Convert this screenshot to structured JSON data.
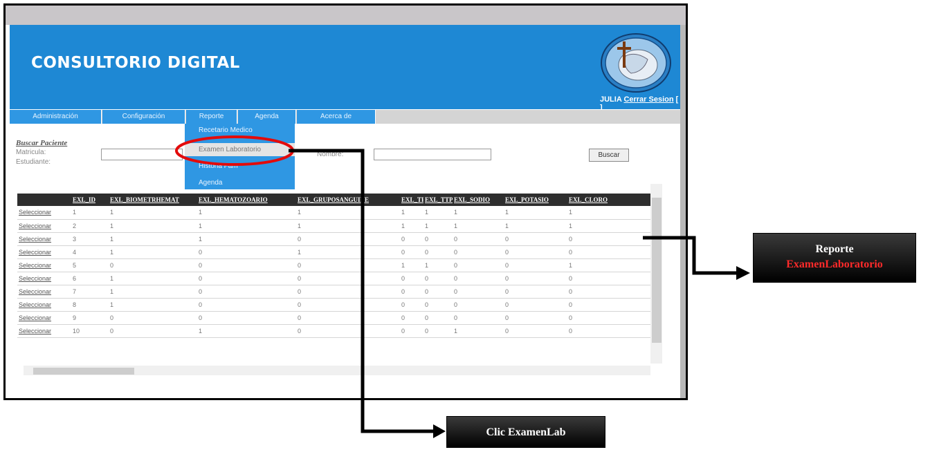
{
  "app": {
    "title": "CONSULTORIO DIGITAL",
    "user": "JULIA",
    "logout_label": "Cerrar Sesion",
    "logout_suffix": "[ ]"
  },
  "menu": {
    "items": [
      {
        "label": "Administración"
      },
      {
        "label": "Configuración"
      },
      {
        "label": "Reporte"
      },
      {
        "label": "Agenda"
      },
      {
        "label": "Acerca de"
      }
    ]
  },
  "dropdown": {
    "items": [
      {
        "label": "Recetario Medico"
      },
      {
        "label": "Examen Laboratorio"
      },
      {
        "label": "Historia Fam"
      },
      {
        "label": "Agenda"
      }
    ]
  },
  "search": {
    "title": "Buscar Paciente",
    "matricula_label": "Matricula:",
    "estudiante_label": "Estudiante:",
    "nombre_label": "Nombre:",
    "matricula_value": "",
    "nombre_value": "",
    "button_label": "Buscar"
  },
  "grid": {
    "columns": [
      "",
      "EXL_ID",
      "EXL_BIOMETRHEMAT",
      "EXL_HEMATOZOARIO",
      "EXL_GRUPOSANGUINE",
      "EXL_TP",
      "EXL_TTP",
      "EXL_SODIO",
      "EXL_POTASIO",
      "EXL_CLORO"
    ],
    "select_label": "Seleccionar",
    "rows": [
      [
        "1",
        "1",
        "1",
        "1",
        "1",
        "1",
        "1",
        "1",
        "1"
      ],
      [
        "2",
        "1",
        "1",
        "1",
        "1",
        "1",
        "1",
        "1",
        "1"
      ],
      [
        "3",
        "1",
        "1",
        "0",
        "0",
        "0",
        "0",
        "0",
        "0"
      ],
      [
        "4",
        "1",
        "0",
        "1",
        "0",
        "0",
        "0",
        "0",
        "0"
      ],
      [
        "5",
        "0",
        "0",
        "0",
        "1",
        "1",
        "0",
        "0",
        "1"
      ],
      [
        "6",
        "1",
        "0",
        "0",
        "0",
        "0",
        "0",
        "0",
        "0"
      ],
      [
        "7",
        "1",
        "0",
        "0",
        "0",
        "0",
        "0",
        "0",
        "0"
      ],
      [
        "8",
        "1",
        "0",
        "0",
        "0",
        "0",
        "0",
        "0",
        "0"
      ],
      [
        "9",
        "0",
        "0",
        "0",
        "0",
        "0",
        "0",
        "0",
        "0"
      ],
      [
        "10",
        "0",
        "1",
        "0",
        "0",
        "0",
        "1",
        "0",
        "0"
      ]
    ]
  },
  "callouts": {
    "click": "Clic ExamenLab",
    "report_line1": "Reporte",
    "report_line2": "ExamenLaboratorio"
  },
  "colors": {
    "header_blue": "#1e88d4",
    "menu_blue": "#2f97e3",
    "highlight_red": "#e30b0b",
    "callout_red_text": "#ff2a2a"
  }
}
